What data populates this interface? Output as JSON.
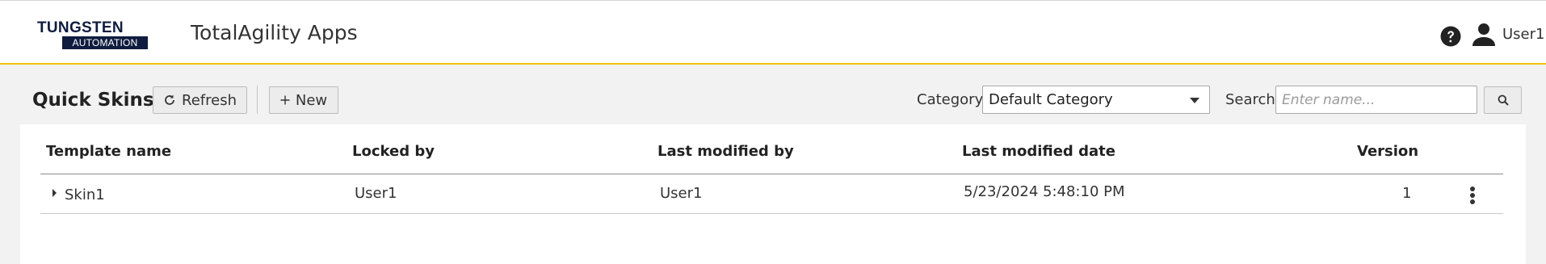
{
  "header": {
    "logo_top": "TUNGSTEN",
    "logo_bottom": "AUTOMATION",
    "app_title": "TotalAgility Apps",
    "help_icon": "question-circle-icon",
    "user_icon": "person-icon",
    "user_name": "User1",
    "accent_color": "#f2c400"
  },
  "toolbar": {
    "page_title": "Quick Skins",
    "refresh_label": "Refresh",
    "refresh_icon": "refresh-icon",
    "new_label": "New",
    "new_icon": "plus-icon",
    "category_label": "Category",
    "category_value": "Default Category",
    "search_label": "Search",
    "search_placeholder": "Enter name...",
    "search_icon": "search-icon"
  },
  "table": {
    "columns": [
      "Template name",
      "Locked by",
      "Last modified by",
      "Last modified date",
      "Version"
    ],
    "rows": [
      {
        "template_name": "Skin1",
        "locked_by": "User1",
        "last_modified_by": "User1",
        "last_modified_date": "5/23/2024 5:48:10 PM",
        "version": "1",
        "expand_icon": "caret-right-icon",
        "menu_icon": "more-vertical-icon"
      }
    ]
  }
}
